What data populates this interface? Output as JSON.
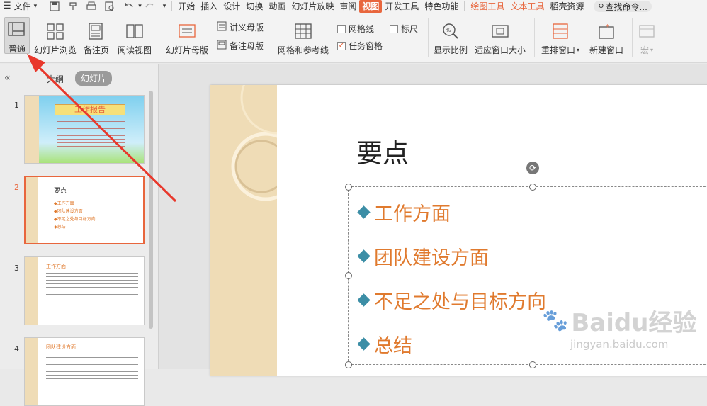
{
  "menubar": {
    "file_label": "文件",
    "tabs": [
      "开始",
      "插入",
      "设计",
      "切换",
      "动画",
      "幻灯片放映",
      "审阅"
    ],
    "active_tab": "视图",
    "tabs2": [
      "开发工具",
      "特色功能"
    ],
    "context_tabs": [
      "绘图工具",
      "文本工具"
    ],
    "extra_tab": "稻壳资源",
    "search_label": "查找命令..."
  },
  "ribbon": {
    "normal": "普通",
    "slide_sorter": "幻灯片浏览",
    "notes_page": "备注页",
    "reading_view": "阅读视图",
    "slide_master": "幻灯片母版",
    "handout_master": "讲义母版",
    "notes_master": "备注母版",
    "grid_guides": "网格和参考线",
    "gridlines": "网格线",
    "ruler": "标尺",
    "task_pane": "任务窗格",
    "zoom": "显示比例",
    "fit_window": "适应窗口大小",
    "arrange": "重排窗口",
    "new_window": "新建窗口",
    "macro": "宏"
  },
  "panel": {
    "outline_tab": "大纲",
    "slides_tab": "幻灯片"
  },
  "thumbs": [
    {
      "num": "1",
      "title": "工作报告"
    },
    {
      "num": "2",
      "title": "要点",
      "items": [
        "工作方面",
        "团队建设方面",
        "不足之处与目标方向",
        "总结"
      ]
    },
    {
      "num": "3",
      "title": "工作方面"
    },
    {
      "num": "4",
      "title": "团队建设方面"
    }
  ],
  "slide": {
    "title": "要点",
    "bullets": [
      "工作方面",
      "团队建设方面",
      "不足之处与目标方向",
      "总结"
    ]
  },
  "watermark": {
    "brand": "Baidu经验",
    "url": "jingyan.baidu.com"
  },
  "colors": {
    "accent": "#e8663d",
    "bullet_text": "#e07a2e",
    "diamond": "#3c8ea6",
    "annotation_arrow": "#e8382c"
  }
}
